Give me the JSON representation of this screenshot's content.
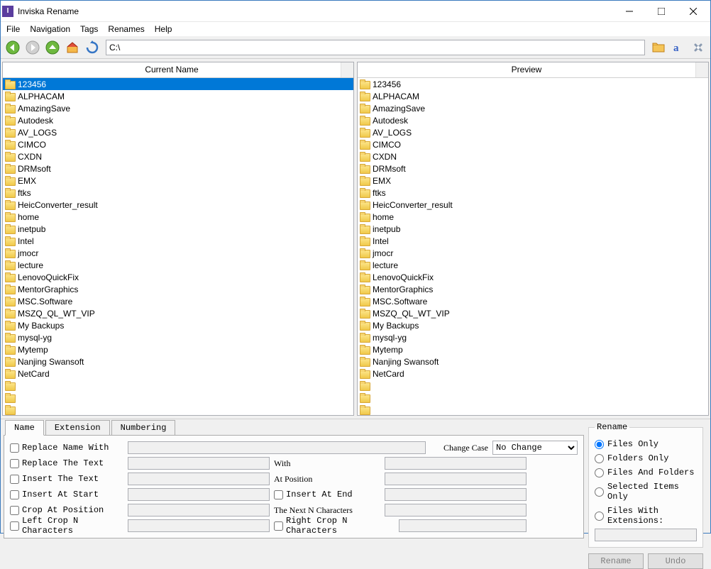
{
  "window": {
    "title": "Inviska Rename"
  },
  "menu": {
    "file": "File",
    "navigation": "Navigation",
    "tags": "Tags",
    "renames": "Renames",
    "help": "Help"
  },
  "toolbar": {
    "path": "C:\\"
  },
  "panels": {
    "current_header": "Current Name",
    "preview_header": "Preview",
    "items": [
      "123456",
      "ALPHACAM",
      "AmazingSave",
      "Autodesk",
      "AV_LOGS",
      "CIMCO",
      "CXDN",
      "DRMsoft",
      "EMX",
      "ftks",
      "HeicConverter_result",
      "home",
      "inetpub",
      "Intel",
      "jmocr",
      "lecture",
      "LenovoQuickFix",
      "MentorGraphics",
      "MSC.Software",
      "MSZQ_QL_WT_VIP",
      "My Backups",
      "mysql-yg",
      "Mytemp",
      "Nanjing Swansoft",
      "NetCard"
    ],
    "selected": 0
  },
  "tabs": {
    "name": "Name",
    "extension": "Extension",
    "numbering": "Numbering"
  },
  "form": {
    "replace_name_with": "Replace Name With",
    "change_case": "Change Case",
    "change_case_value": "No Change",
    "replace_the_text": "Replace The Text",
    "with": "With",
    "insert_the_text": "Insert The Text",
    "at_position": "At Position",
    "insert_at_start": "Insert At Start",
    "insert_at_end": "Insert At End",
    "crop_at_position": "Crop At Position",
    "the_next_n": "The Next N Characters",
    "left_crop_n": "Left Crop N Characters",
    "right_crop_n": "Right Crop N Characters"
  },
  "rename_group": {
    "legend": "Rename",
    "files_only": "Files Only",
    "folders_only": "Folders Only",
    "files_and_folders": "Files And Folders",
    "selected_items_only": "Selected Items Only",
    "files_with_ext": "Files With Extensions:"
  },
  "buttons": {
    "rename": "Rename",
    "undo": "Undo"
  }
}
